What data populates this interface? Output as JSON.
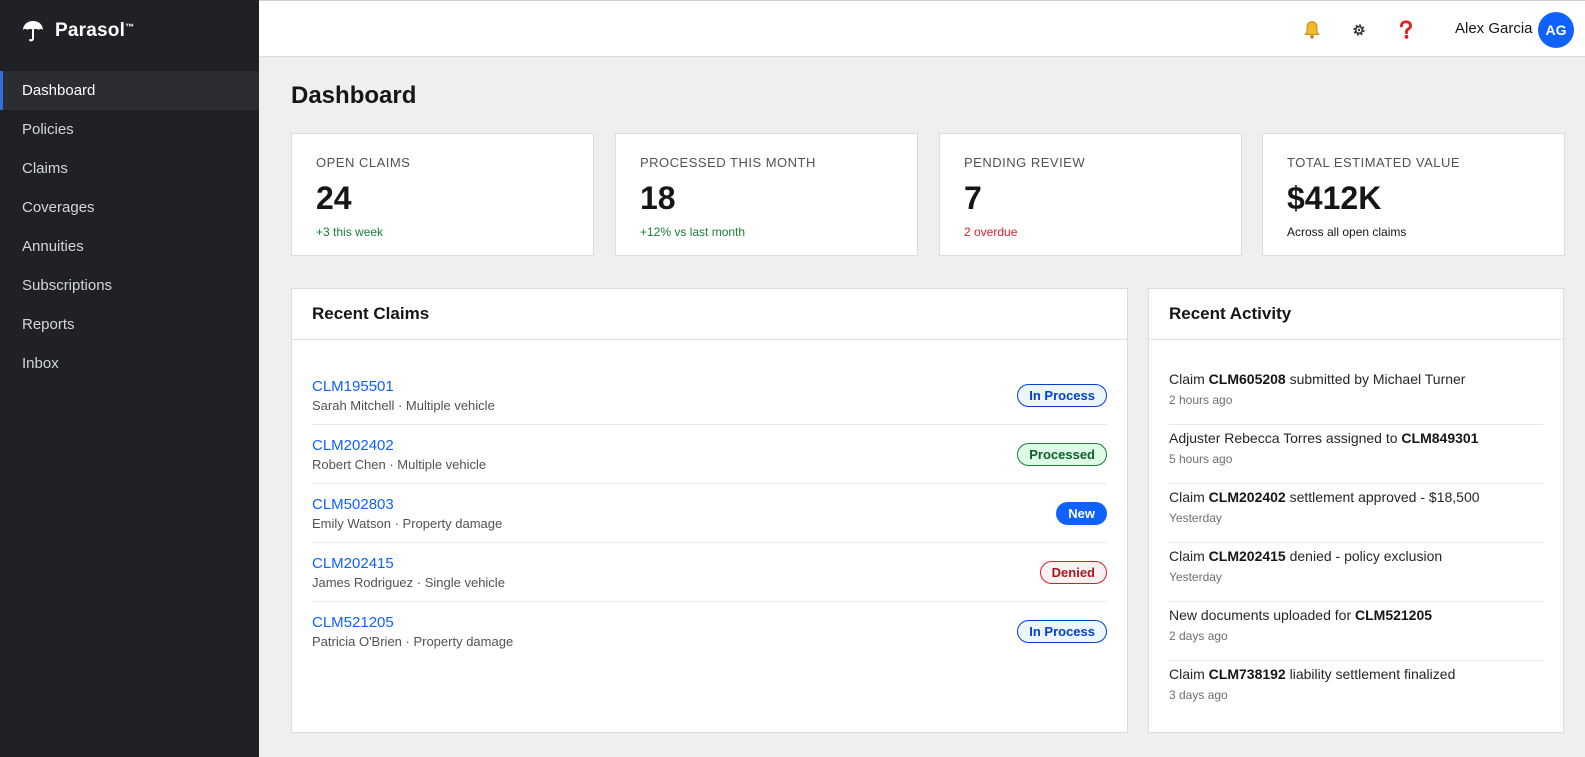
{
  "brand": {
    "name": "Parasol",
    "mark": "™"
  },
  "sidebar": {
    "items": [
      {
        "label": "Dashboard",
        "active": true
      },
      {
        "label": "Policies"
      },
      {
        "label": "Claims"
      },
      {
        "label": "Coverages"
      },
      {
        "label": "Annuities"
      },
      {
        "label": "Subscriptions"
      },
      {
        "label": "Reports"
      },
      {
        "label": "Inbox"
      }
    ]
  },
  "header": {
    "icons": [
      "bell-icon",
      "gear-icon",
      "help-icon"
    ],
    "user_name": "Alex Garcia",
    "avatar_initials": "AG"
  },
  "page": {
    "title": "Dashboard"
  },
  "stats": [
    {
      "label": "OPEN CLAIMS",
      "value": "24",
      "sub": "+3 this week",
      "tone": "pos"
    },
    {
      "label": "PROCESSED THIS MONTH",
      "value": "18",
      "sub": "+12% vs last month",
      "tone": "pos"
    },
    {
      "label": "PENDING REVIEW",
      "value": "7",
      "sub": "2 overdue",
      "tone": "neg"
    },
    {
      "label": "TOTAL ESTIMATED VALUE",
      "value": "$412K",
      "sub": "Across all open claims",
      "tone": "neutral"
    }
  ],
  "recent_claims": {
    "title": "Recent Claims",
    "rows": [
      {
        "id": "CLM195501",
        "meta": "Sarah Mitchell · Multiple vehicle",
        "status": "In Process",
        "status_class": "inprocess"
      },
      {
        "id": "CLM202402",
        "meta": "Robert Chen · Multiple vehicle",
        "status": "Processed",
        "status_class": "processed"
      },
      {
        "id": "CLM502803",
        "meta": "Emily Watson · Property damage",
        "status": "New",
        "status_class": "new"
      },
      {
        "id": "CLM202415",
        "meta": "James Rodriguez · Single vehicle",
        "status": "Denied",
        "status_class": "denied"
      },
      {
        "id": "CLM521205",
        "meta": "Patricia O'Brien · Property damage",
        "status": "In Process",
        "status_class": "inprocess"
      }
    ]
  },
  "recent_activity": {
    "title": "Recent Activity",
    "rows": [
      {
        "before": "Claim ",
        "bold": "CLM605208",
        "after": " submitted by Michael Turner",
        "time": "2 hours ago"
      },
      {
        "before": "Adjuster Rebecca Torres assigned to ",
        "bold": "CLM849301",
        "after": "",
        "time": "5 hours ago"
      },
      {
        "before": "Claim ",
        "bold": "CLM202402",
        "after": " settlement approved - $18,500",
        "time": "Yesterday"
      },
      {
        "before": "Claim ",
        "bold": "CLM202415",
        "after": " denied - policy exclusion",
        "time": "Yesterday"
      },
      {
        "before": "New documents uploaded for ",
        "bold": "CLM521205",
        "after": "",
        "time": "2 days ago"
      },
      {
        "before": "Claim ",
        "bold": "CLM738192",
        "after": " liability settlement finalized",
        "time": "3 days ago"
      }
    ]
  }
}
